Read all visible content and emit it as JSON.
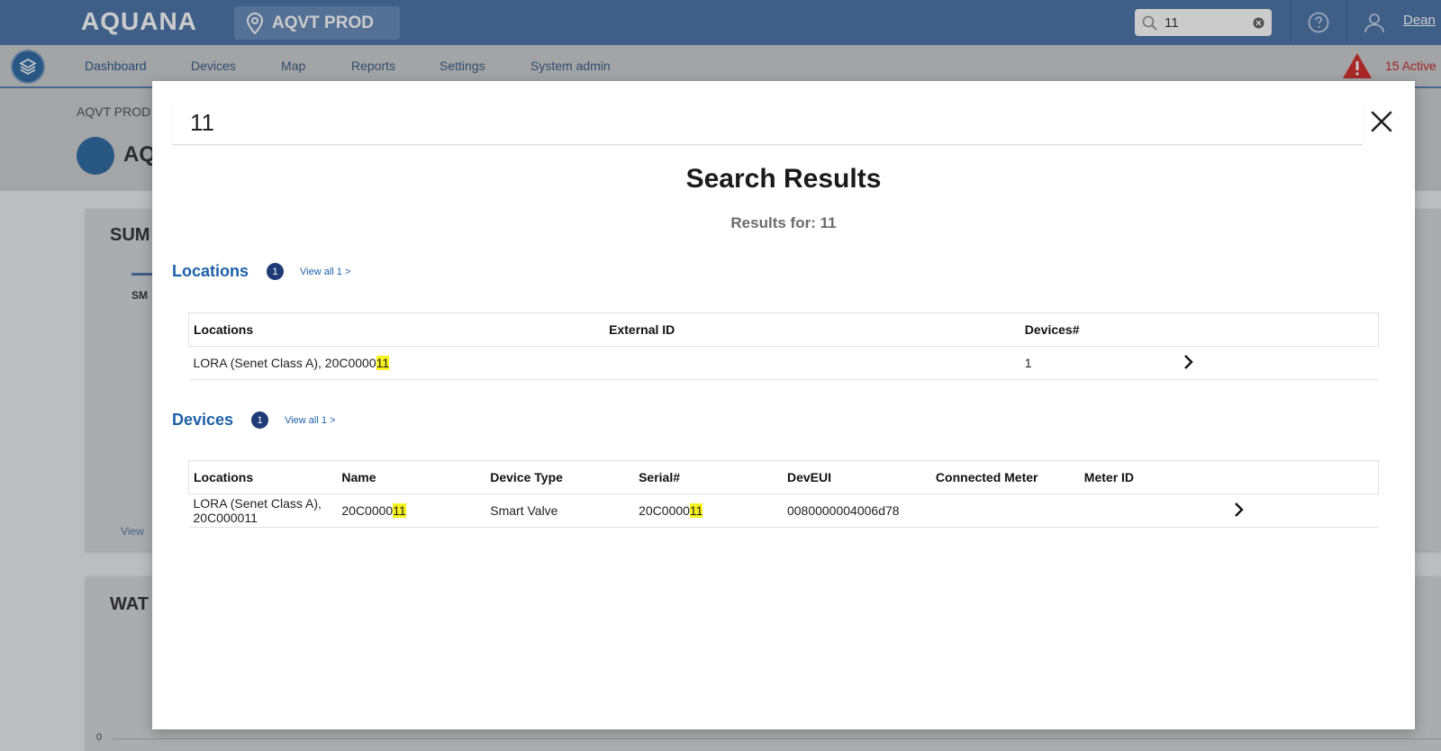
{
  "topbar": {
    "logo": "AQUANA",
    "site": "AQVT PROD",
    "search_value": "11",
    "user": "Dean"
  },
  "nav": {
    "items": [
      "Dashboard",
      "Devices",
      "Map",
      "Reports",
      "Settings",
      "System admin"
    ],
    "alert": "15 Active"
  },
  "background": {
    "breadcrumb": "AQVT PROD",
    "page_title": "AQ",
    "summary_title": "SUM",
    "summary_tab": "SM",
    "water_title": "WAT",
    "view_link": "View",
    "axis_zero": "0"
  },
  "modal": {
    "search_value": "11",
    "title": "Search Results",
    "results_for_label": "Results for:",
    "results_for_value": "11",
    "locations": {
      "title": "Locations",
      "count": "1",
      "view_all": "View all 1 >",
      "columns": [
        "Locations",
        "External ID",
        "Devices#"
      ],
      "rows": [
        {
          "location_prefix": "LORA (Senet Class A), 20C0000",
          "location_match": "11",
          "external_id": "",
          "devices": "1"
        }
      ]
    },
    "devices": {
      "title": "Devices",
      "count": "1",
      "view_all": "View all 1 >",
      "columns": [
        "Locations",
        "Name",
        "Device Type",
        "Serial#",
        "DevEUI",
        "Connected Meter",
        "Meter ID"
      ],
      "rows": [
        {
          "location": "LORA (Senet Class A), 20C000011",
          "name_prefix": "20C0000",
          "name_match": "11",
          "device_type": "Smart Valve",
          "serial_prefix": "20C0000",
          "serial_match": "11",
          "deveui": "0080000004006d78",
          "connected_meter": "",
          "meter_id": ""
        }
      ]
    }
  },
  "colors": {
    "topbar": "#3d6aa2",
    "accent": "#1e5fa8",
    "highlight": "#f7f21c",
    "alert": "#c21a1a"
  }
}
